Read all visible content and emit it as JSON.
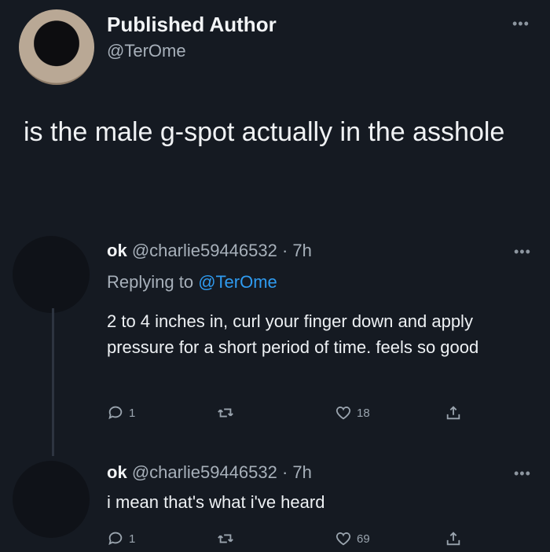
{
  "post": {
    "author_name": "Published Author",
    "author_handle": "@TerOme",
    "text": "is the male g-spot actually in the asshole"
  },
  "replies": [
    {
      "name": "ok",
      "handle": "@charlie59446532",
      "separator": "·",
      "time": "7h",
      "replying_label": "Replying to",
      "replying_to": "@TerOme",
      "text": "2 to 4 inches in, curl your finger down and apply pressure for a short period of time. feels so good",
      "reply_count": "1",
      "like_count": "18"
    },
    {
      "name": "ok",
      "handle": "@charlie59446532",
      "separator": "·",
      "time": "7h",
      "text": "i mean that's what i've heard",
      "reply_count": "1",
      "like_count": "69"
    }
  ],
  "more_icon": "more-horizontal-icon",
  "colors": {
    "background": "#151a22",
    "mention": "#2f9bf0",
    "muted": "#a7b0ba"
  }
}
